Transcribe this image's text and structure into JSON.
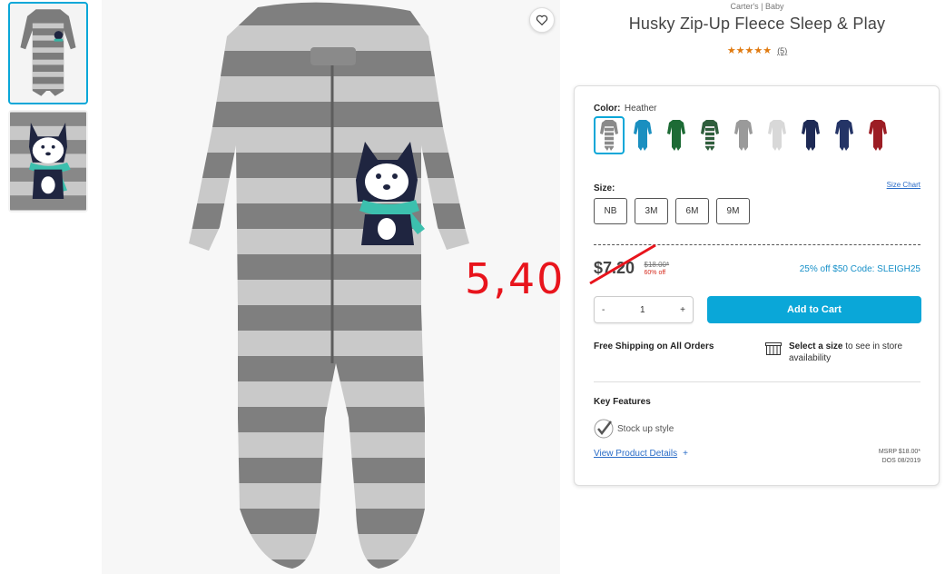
{
  "product": {
    "brand": "Carter's | Baby",
    "title": "Husky Zip-Up Fleece Sleep & Play",
    "stars": "★★★★★",
    "review_count": "(5)"
  },
  "overlay_annotation": "5,40",
  "color": {
    "label": "Color:",
    "selected": "Heather",
    "swatches": [
      {
        "name": "heather-stripe",
        "color": "#8a8a8a"
      },
      {
        "name": "blue",
        "color": "#1a8fc0"
      },
      {
        "name": "green",
        "color": "#1d6b35"
      },
      {
        "name": "green-stripe",
        "color": "#2f5e3c"
      },
      {
        "name": "grey",
        "color": "#9a9a9a"
      },
      {
        "name": "light-print",
        "color": "#d8d8d8"
      },
      {
        "name": "navy",
        "color": "#1e2a55"
      },
      {
        "name": "navy-print",
        "color": "#243466"
      },
      {
        "name": "red-plaid",
        "color": "#9c1d24"
      }
    ]
  },
  "size": {
    "label": "Size:",
    "chart_link": "Size Chart",
    "options": [
      "NB",
      "3M",
      "6M",
      "9M"
    ]
  },
  "price": {
    "current": "$7.20",
    "original": "$18.00*",
    "discount": "60% off",
    "promo": "25% off $50 Code: SLEIGH25"
  },
  "cart": {
    "minus": "-",
    "quantity": "1",
    "plus": "+",
    "add_label": "Add to Cart"
  },
  "shipping": {
    "free": "Free Shipping on All Orders",
    "store_bold": "Select a size",
    "store_rest": " to see in store availability"
  },
  "features": {
    "title": "Key Features",
    "item": "Stock up style",
    "details_link": "View Product Details",
    "details_plus": "+",
    "msrp": "MSRP $18.00*",
    "dos": "DOS 08/2019"
  }
}
